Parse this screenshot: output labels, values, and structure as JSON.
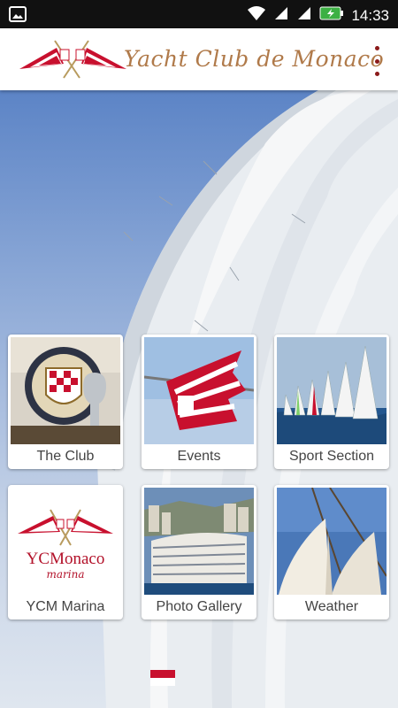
{
  "status_bar": {
    "time": "14:33",
    "icons": [
      "image-notification-icon",
      "wifi-icon",
      "cell-signal-icon",
      "cell-signal-icon",
      "battery-charging-icon"
    ]
  },
  "app_bar": {
    "title": "Yacht Club de Monaco",
    "menu_icon": "more-vertical-icon"
  },
  "tiles": [
    {
      "label": "The Club",
      "image": "club-emblem-photo"
    },
    {
      "label": "Events",
      "image": "flag-photo"
    },
    {
      "label": "Sport Section",
      "image": "regatta-photo"
    },
    {
      "label": "YCM Marina",
      "image": "ycm-marina-logo",
      "logo_text": "YCMonaco",
      "logo_subtext": "marina"
    },
    {
      "label": "Photo Gallery",
      "image": "clubhouse-photo"
    },
    {
      "label": "Weather",
      "image": "sails-photo"
    }
  ],
  "colors": {
    "title": "#b07a4a",
    "menu": "#8b1a1a",
    "brand_red": "#c8102e"
  }
}
